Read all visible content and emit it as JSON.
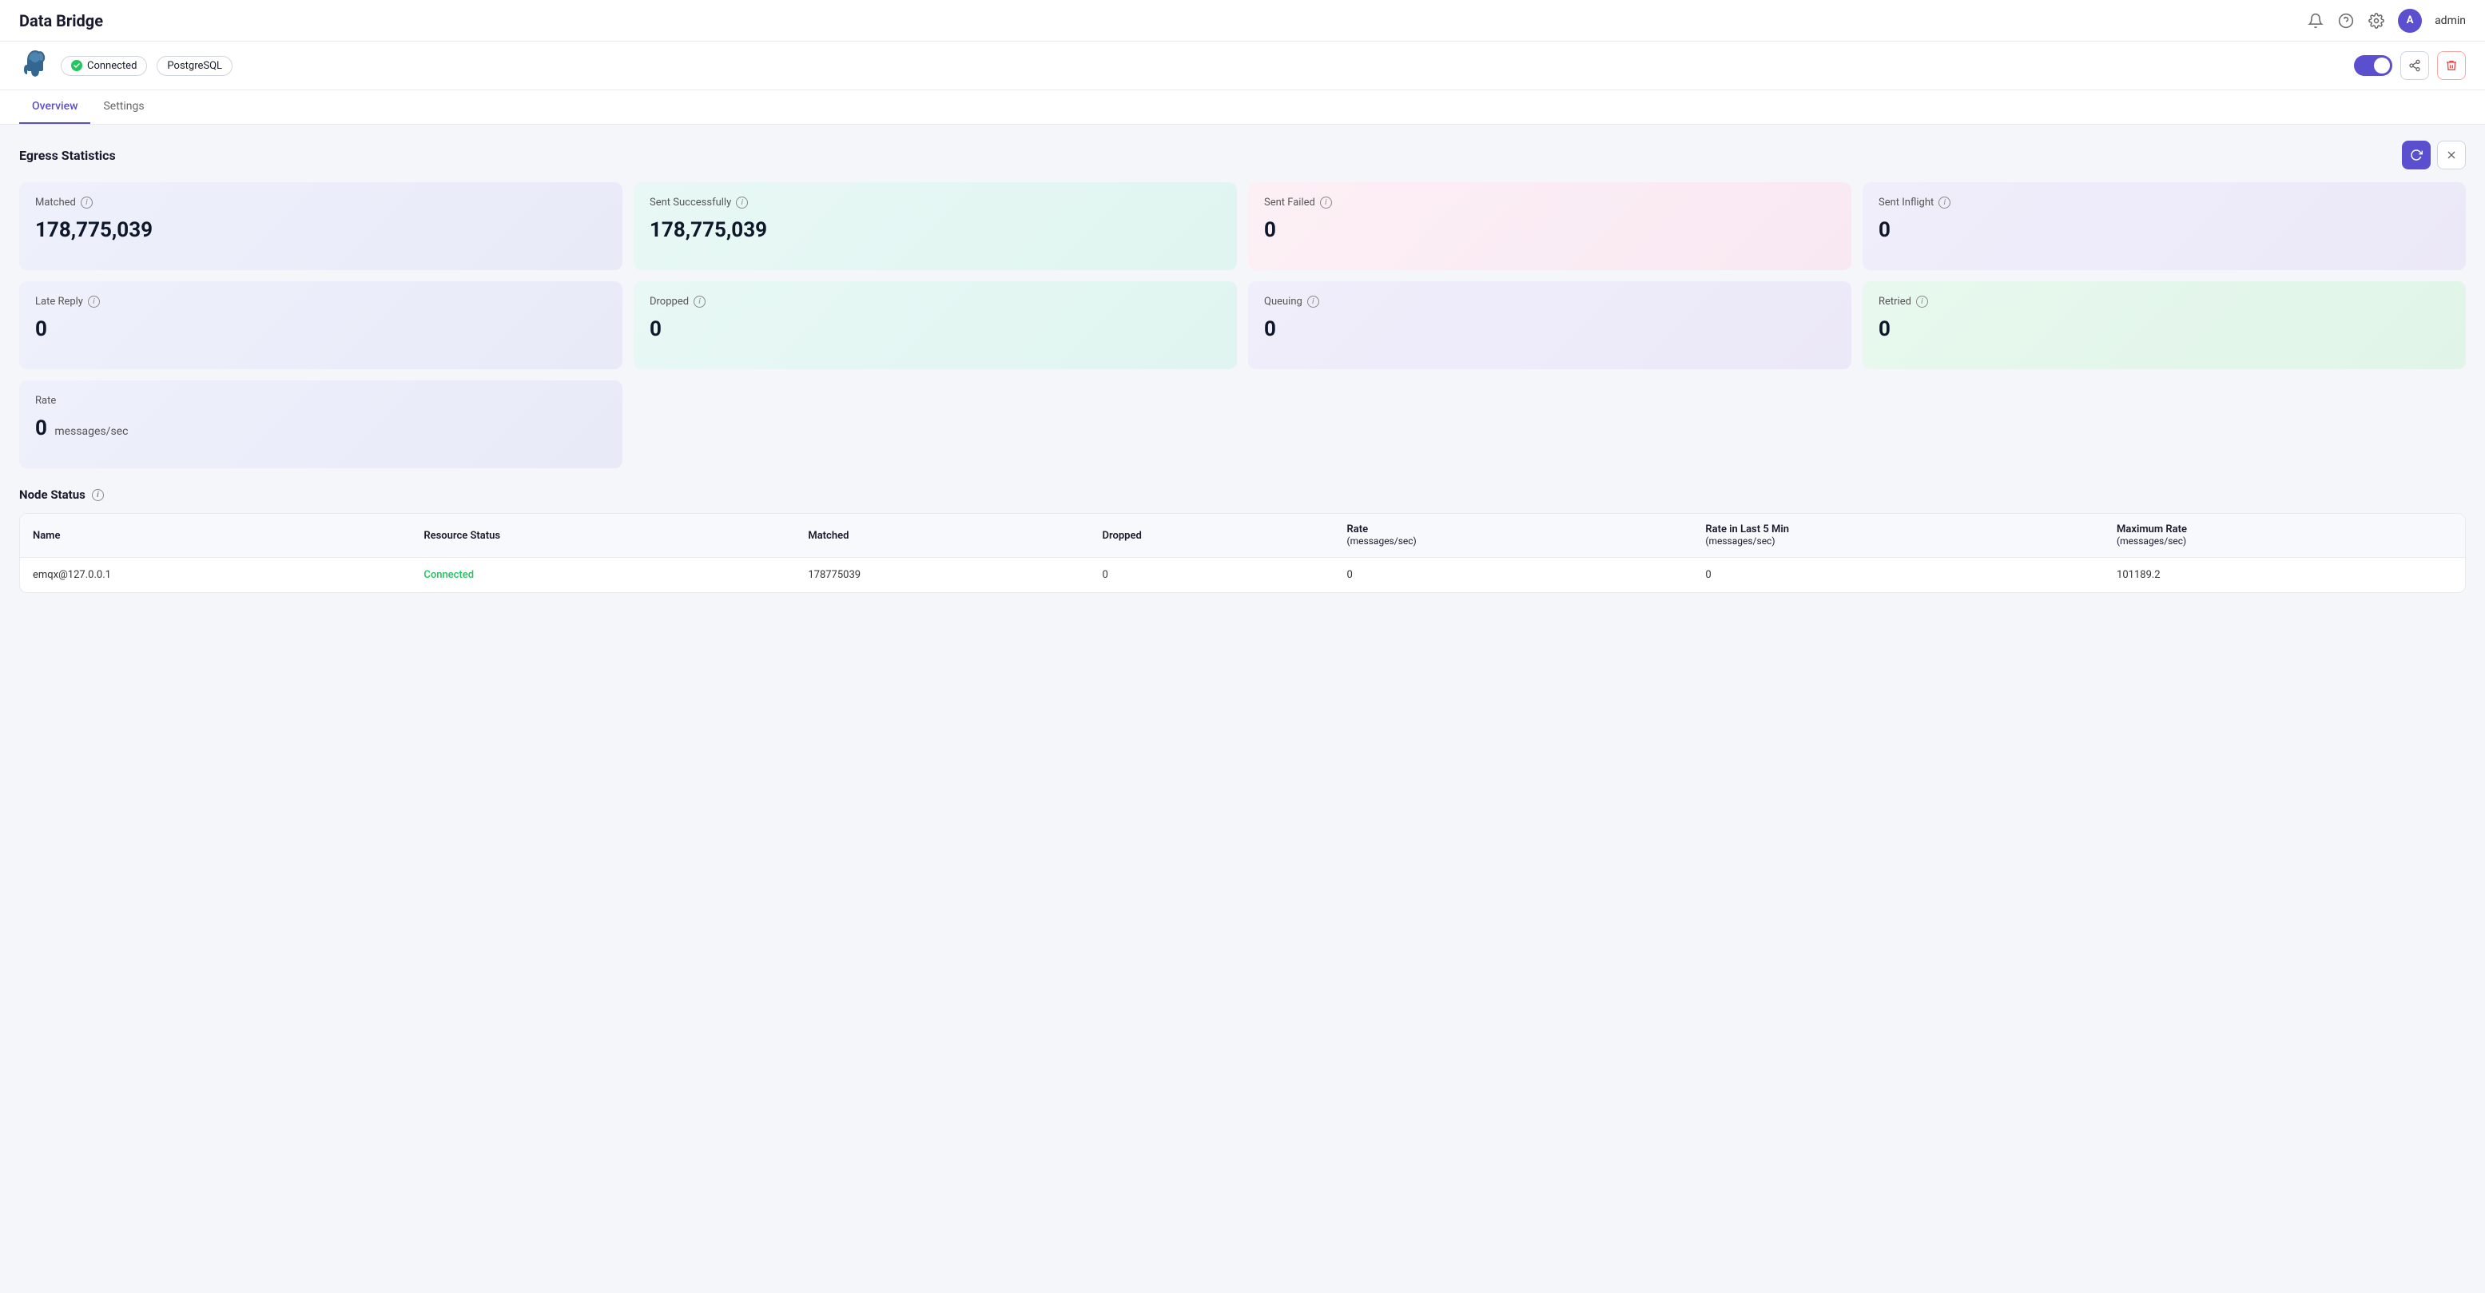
{
  "app": {
    "title": "Data Bridge"
  },
  "header": {
    "title": "Data Bridge",
    "user": {
      "avatar_letter": "A",
      "name": "admin"
    },
    "icons": {
      "bell": "🔔",
      "help": "?",
      "gear": "⚙"
    }
  },
  "subheader": {
    "connected_label": "Connected",
    "db_type": "PostgreSQL",
    "toggle_state": true
  },
  "tabs": [
    {
      "label": "Overview",
      "active": true
    },
    {
      "label": "Settings",
      "active": false
    }
  ],
  "egress": {
    "section_title": "Egress Statistics",
    "stats": [
      {
        "label": "Matched",
        "value": "178,775,039",
        "unit": "",
        "card": "card-blue"
      },
      {
        "label": "Sent Successfully",
        "value": "178,775,039",
        "unit": "",
        "card": "card-teal"
      },
      {
        "label": "Sent Failed",
        "value": "0",
        "unit": "",
        "card": "card-pink"
      },
      {
        "label": "Sent Inflight",
        "value": "0",
        "unit": "",
        "card": "card-lavender"
      },
      {
        "label": "Late Reply",
        "value": "0",
        "unit": "",
        "card": "card-blue"
      },
      {
        "label": "Dropped",
        "value": "0",
        "unit": "",
        "card": "card-teal"
      },
      {
        "label": "Queuing",
        "value": "0",
        "unit": "",
        "card": "card-lavender"
      },
      {
        "label": "Retried",
        "value": "0",
        "unit": "",
        "card": "card-green"
      },
      {
        "label": "Rate",
        "value": "0",
        "unit": "messages/sec",
        "card": "card-blue"
      }
    ]
  },
  "node_status": {
    "title": "Node Status",
    "columns": [
      "Name",
      "Resource Status",
      "Matched",
      "Dropped",
      "Rate\n(messages/sec)",
      "Rate in Last 5 Min\n(messages/sec)",
      "Maximum Rate\n(messages/sec)"
    ],
    "rows": [
      {
        "name": "emqx@127.0.0.1",
        "resource_status": "Connected",
        "matched": "178775039",
        "dropped": "0",
        "rate": "0",
        "rate_5min": "0",
        "max_rate": "101189.2"
      }
    ]
  }
}
